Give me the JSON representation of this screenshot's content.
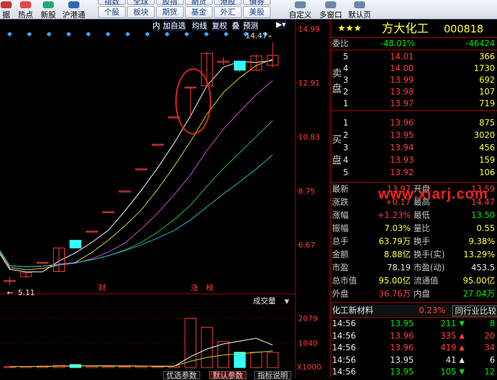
{
  "toolbar": {
    "left_buttons": [
      {
        "label": "据",
        "icon": "data-icon"
      },
      {
        "label": "热点",
        "icon": "hotspot-icon"
      },
      {
        "label": "新股",
        "icon": "new-stock-icon"
      },
      {
        "label": "沪港通",
        "icon": "shhk-connect-icon"
      }
    ],
    "grid_top": [
      "指数",
      "全球",
      "股指",
      "期货",
      "港股",
      "債券"
    ],
    "grid_bottom": [
      "个股",
      "板块",
      "期货",
      "基金",
      "外汇",
      "美股"
    ],
    "right_buttons": [
      {
        "label": "自定义",
        "icon": "custom-icon"
      },
      {
        "label": "多窗口",
        "icon": "multi-window-icon"
      },
      {
        "label": "默认页",
        "icon": "default-page-icon"
      }
    ]
  },
  "chart": {
    "menu": [
      "内",
      "加自选",
      "均线",
      "复权",
      "叠",
      "预测"
    ],
    "price_labels": [
      "14.99",
      "12.91",
      "10.83",
      "8.75",
      "6.67"
    ],
    "high_marker": "14.47",
    "low_marker": "5.11",
    "event_markers": [
      "财",
      "涨",
      "榜"
    ],
    "volume_title": "成交量",
    "volume_labels": [
      "2079",
      "1040",
      "X1000"
    ],
    "bottom_tabs": [
      "优选参数",
      "默认参数",
      "指标说明"
    ]
  },
  "quote": {
    "stars": "★★★",
    "name": "方大化工",
    "code": "000818",
    "weibi_label": "委比",
    "weibi": "-48.01%",
    "weicha": "-46424",
    "sell_label": [
      "卖",
      "盘"
    ],
    "sell": [
      {
        "n": "5",
        "price": "14.01",
        "vol": "366"
      },
      {
        "n": "4",
        "price": "14.00",
        "vol": "1730"
      },
      {
        "n": "3",
        "price": "13.99",
        "vol": "692"
      },
      {
        "n": "2",
        "price": "13.98",
        "vol": "107"
      },
      {
        "n": "1",
        "price": "13.97",
        "vol": "719"
      }
    ],
    "buy_label": [
      "买",
      "盘"
    ],
    "buy": [
      {
        "n": "1",
        "price": "13.96",
        "vol": "875"
      },
      {
        "n": "2",
        "price": "13.95",
        "vol": "3020"
      },
      {
        "n": "3",
        "price": "13.94",
        "vol": "456"
      },
      {
        "n": "4",
        "price": "13.93",
        "vol": "159"
      },
      {
        "n": "5",
        "price": "13.92",
        "vol": "106"
      }
    ],
    "stats": [
      {
        "l1": "最新",
        "v1": "13.97",
        "l2": "开盘",
        "v2": "13.59",
        "c1": "red",
        "c2": "red"
      },
      {
        "l1": "涨跌",
        "v1": "+0.17",
        "l2": "最高",
        "v2": "14.47",
        "c1": "red",
        "c2": "red"
      },
      {
        "l1": "涨幅",
        "v1": "+1.23%",
        "l2": "最低",
        "v2": "13.50",
        "c1": "red",
        "c2": "green"
      },
      {
        "l1": "振幅",
        "v1": "7.03%",
        "l2": "量比",
        "v2": "0.55",
        "c1": "yellow",
        "c2": "yellow"
      },
      {
        "l1": "总手",
        "v1": "63.79万",
        "l2": "换手",
        "v2": "9.38%",
        "c1": "yellow",
        "c2": "yellow"
      },
      {
        "l1": "金额",
        "v1": "8.88亿",
        "l2": "换手(实)",
        "v2": "13.29%",
        "c1": "yellow",
        "c2": "yellow"
      },
      {
        "l1": "市盈",
        "v1": "78.19",
        "l2": "市盈(动)",
        "v2": "453.5",
        "c1": "white",
        "c2": "white"
      },
      {
        "l1": "总市值",
        "v1": "95.00亿",
        "l2": "流通值",
        "v2": "95.00亿",
        "c1": "yellow",
        "c2": "yellow"
      },
      {
        "l1": "外盘",
        "v1": "36.76万",
        "l2": "内盘",
        "v2": "27.04万",
        "c1": "red",
        "c2": "green"
      }
    ],
    "sector_name": "化工新材料",
    "sector_change": "0.23%",
    "sector_compare": "同行业比较",
    "ticks": [
      {
        "time": "14:56",
        "price": "13.95",
        "vol": "211",
        "dir": "down",
        "n": "8"
      },
      {
        "time": "14:56",
        "price": "13.96",
        "vol": "335",
        "dir": "up",
        "n": "20"
      },
      {
        "time": "14:56",
        "price": "13.96",
        "vol": "419",
        "dir": "up",
        "n": "34"
      },
      {
        "time": "14:56",
        "price": "13.95",
        "vol": "41",
        "dir": "flat",
        "n": "6"
      },
      {
        "time": "14:56",
        "price": "13.95",
        "vol": "105",
        "dir": "down",
        "n": "12"
      }
    ]
  },
  "watermark": "www.xiarj.com",
  "chart_data": {
    "type": "candlestick",
    "ylim": [
      5.0,
      15.2
    ],
    "ticks": [
      14.99,
      12.91,
      10.83,
      8.75,
      6.67
    ],
    "candles": [
      {
        "o": 5.3,
        "h": 5.45,
        "l": 5.11,
        "c": 5.3,
        "color": "red"
      },
      {
        "o": 5.45,
        "h": 5.6,
        "l": 5.4,
        "c": 5.6,
        "color": "red"
      },
      {
        "o": 6.0,
        "h": 6.0,
        "l": 6.0,
        "c": 6.0,
        "color": "red"
      },
      {
        "o": 5.65,
        "h": 6.55,
        "l": 5.65,
        "c": 6.55,
        "color": "red"
      },
      {
        "o": 6.85,
        "h": 6.85,
        "l": 6.55,
        "c": 6.55,
        "color": "cyan"
      },
      {
        "o": 7.2,
        "h": 7.2,
        "l": 7.2,
        "c": 7.2,
        "color": "red"
      },
      {
        "o": 7.95,
        "h": 7.95,
        "l": 7.95,
        "c": 7.95,
        "color": "red"
      },
      {
        "o": 8.75,
        "h": 8.75,
        "l": 8.75,
        "c": 8.75,
        "color": "red"
      },
      {
        "o": 9.6,
        "h": 9.6,
        "l": 9.6,
        "c": 9.6,
        "color": "red"
      },
      {
        "o": 10.55,
        "h": 10.55,
        "l": 10.55,
        "c": 10.55,
        "color": "red"
      },
      {
        "o": 11.6,
        "h": 11.6,
        "l": 11.6,
        "c": 11.6,
        "color": "red"
      },
      {
        "o": 12.75,
        "h": 12.75,
        "l": 11.55,
        "c": 12.75,
        "color": "red"
      },
      {
        "o": 12.8,
        "h": 14.1,
        "l": 12.8,
        "c": 14.05,
        "color": "red"
      },
      {
        "o": 13.7,
        "h": 13.9,
        "l": 13.6,
        "c": 13.75,
        "color": "red"
      },
      {
        "o": 13.75,
        "h": 13.75,
        "l": 13.35,
        "c": 13.4,
        "color": "cyan"
      },
      {
        "o": 13.4,
        "h": 14.0,
        "l": 13.4,
        "c": 13.95,
        "color": "red"
      },
      {
        "o": 13.59,
        "h": 14.47,
        "l": 13.5,
        "c": 13.97,
        "color": "red"
      }
    ],
    "volume": [
      {
        "v": 40,
        "color": "red"
      },
      {
        "v": 45,
        "color": "red"
      },
      {
        "v": 60,
        "color": "red"
      },
      {
        "v": 90,
        "color": "red"
      },
      {
        "v": 130,
        "color": "cyan"
      },
      {
        "v": 55,
        "color": "red"
      },
      {
        "v": 50,
        "color": "red"
      },
      {
        "v": 45,
        "color": "red"
      },
      {
        "v": 50,
        "color": "red"
      },
      {
        "v": 45,
        "color": "red"
      },
      {
        "v": 60,
        "color": "red"
      },
      {
        "v": 2079,
        "color": "red"
      },
      {
        "v": 1700,
        "color": "red"
      },
      {
        "v": 1100,
        "color": "red"
      },
      {
        "v": 650,
        "color": "cyan"
      },
      {
        "v": 650,
        "color": "red"
      },
      {
        "v": 640,
        "color": "red"
      }
    ]
  }
}
